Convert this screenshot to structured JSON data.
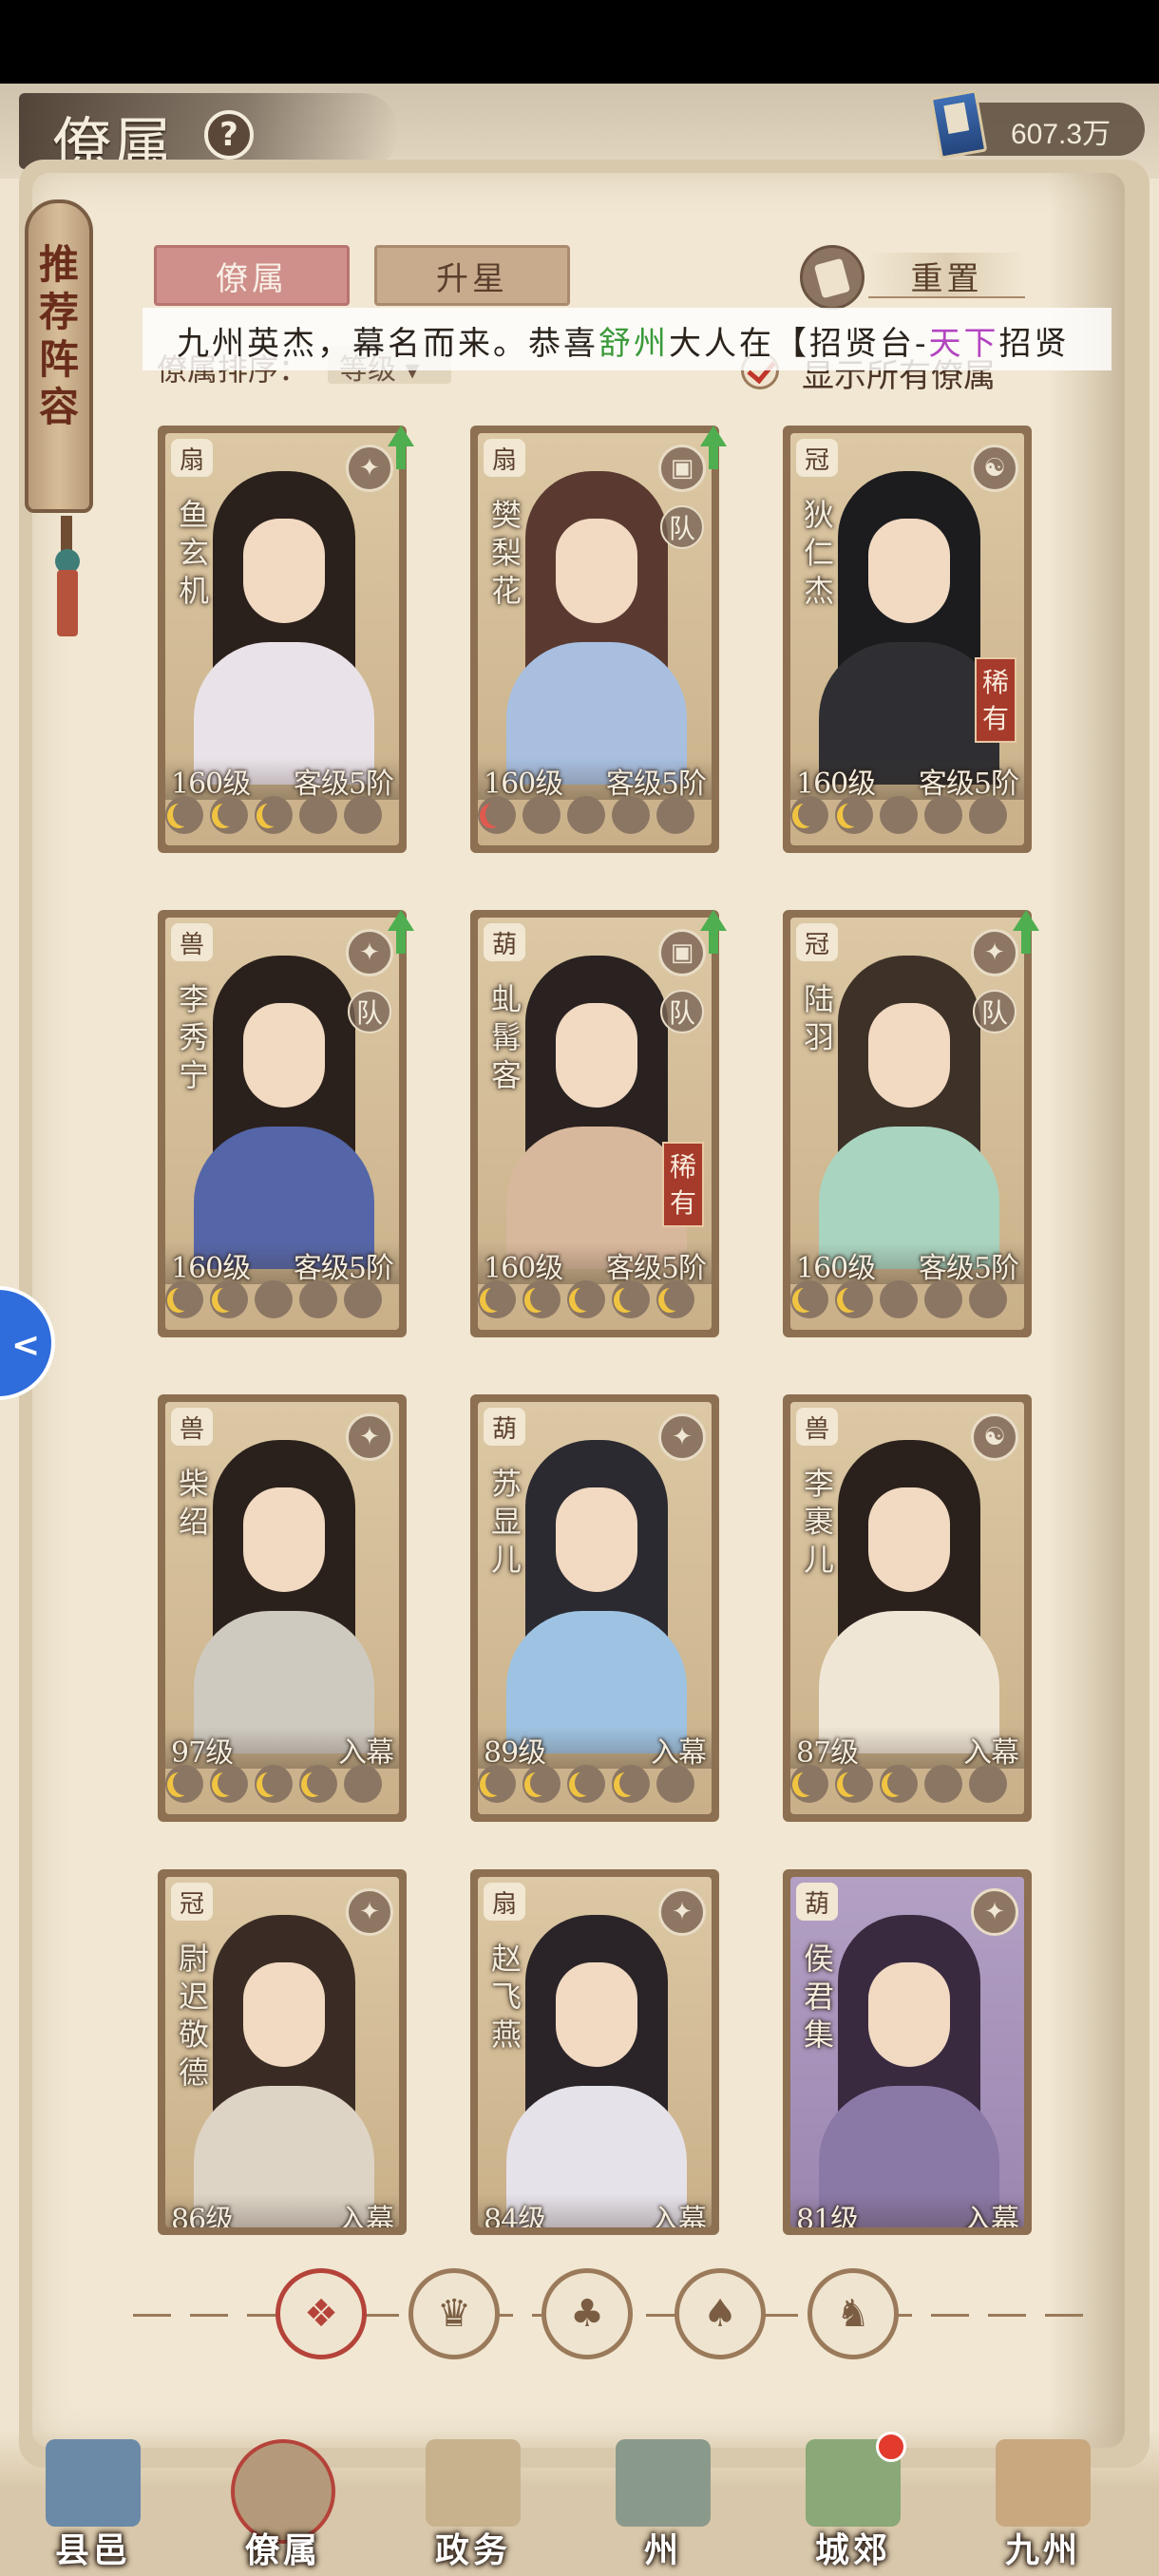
{
  "header": {
    "title": "僚属",
    "help_icon": "?",
    "currency_value": "607.3万"
  },
  "bookmark": {
    "label": "推荐阵容"
  },
  "tabs": [
    {
      "label": "僚属",
      "active": true
    },
    {
      "label": "升星",
      "active": false
    }
  ],
  "reset_label": "重置",
  "marquee": {
    "part1": "九州英杰，幕名而来。恭喜",
    "player": "舒州",
    "part2": "大人在【招贤台-",
    "event": "天下",
    "part3": "招贤"
  },
  "sort": {
    "label": "僚属排序：",
    "value": "等级"
  },
  "show_all_label": "显示所有僚属",
  "cards": [
    {
      "name": "鱼玄机",
      "level": "160级",
      "stage": "客级5阶",
      "cat": "扇",
      "role": "✦",
      "team": false,
      "rare": false,
      "upgrade": true,
      "moons": [
        "on",
        "on",
        "on",
        "off",
        "off"
      ],
      "body_color": "#e9e2e8",
      "hair_color": "#2b211c"
    },
    {
      "name": "樊梨花",
      "level": "160级",
      "stage": "客级5阶",
      "cat": "扇",
      "role": "▣",
      "team": true,
      "rare": false,
      "upgrade": true,
      "moons": [
        "red",
        "off",
        "off",
        "off",
        "off"
      ],
      "body_color": "#a8bfe0",
      "hair_color": "#5a3a30"
    },
    {
      "name": "狄仁杰",
      "level": "160级",
      "stage": "客级5阶",
      "cat": "冠",
      "role": "☯",
      "team": false,
      "rare": true,
      "upgrade": false,
      "moons": [
        "on",
        "on",
        "off",
        "off",
        "off"
      ],
      "body_color": "#2f2f33",
      "hair_color": "#1c1c1e"
    },
    {
      "name": "李秀宁",
      "level": "160级",
      "stage": "客级5阶",
      "cat": "兽",
      "role": "✦",
      "team": true,
      "rare": false,
      "upgrade": true,
      "moons": [
        "on",
        "on",
        "off",
        "off",
        "off"
      ],
      "body_color": "#5566a8",
      "hair_color": "#2b211c"
    },
    {
      "name": "虬髯客",
      "level": "160级",
      "stage": "客级5阶",
      "cat": "葫",
      "role": "▣",
      "team": true,
      "rare": true,
      "upgrade": true,
      "moons": [
        "on",
        "on",
        "on",
        "on",
        "on"
      ],
      "body_color": "#d8b89c",
      "hair_color": "#2a2220"
    },
    {
      "name": "陆羽",
      "level": "160级",
      "stage": "客级5阶",
      "cat": "冠",
      "role": "✦",
      "team": true,
      "rare": false,
      "upgrade": true,
      "moons": [
        "on",
        "on",
        "off",
        "off",
        "off"
      ],
      "body_color": "#a9d4c0",
      "hair_color": "#3d3128"
    },
    {
      "name": "柴绍",
      "level": "97级",
      "stage": "入幕",
      "cat": "兽",
      "role": "✦",
      "team": false,
      "rare": false,
      "upgrade": false,
      "moons": [
        "on",
        "on",
        "on",
        "on",
        "off"
      ],
      "body_color": "#cfcac0",
      "hair_color": "#2b211c"
    },
    {
      "name": "苏显儿",
      "level": "89级",
      "stage": "入幕",
      "cat": "葫",
      "role": "✦",
      "team": false,
      "rare": false,
      "upgrade": false,
      "moons": [
        "on",
        "on",
        "on",
        "on",
        "off"
      ],
      "body_color": "#9ec3e2",
      "hair_color": "#2b2a30"
    },
    {
      "name": "李裹儿",
      "level": "87级",
      "stage": "入幕",
      "cat": "兽",
      "role": "☯",
      "team": false,
      "rare": false,
      "upgrade": false,
      "moons": [
        "on",
        "on",
        "on",
        "off",
        "off"
      ],
      "body_color": "#efe6d6",
      "hair_color": "#2b211c"
    },
    {
      "name": "尉迟敬德",
      "level": "86级",
      "stage": "入幕",
      "cat": "冠",
      "role": "✦",
      "team": false,
      "rare": false,
      "upgrade": false,
      "moons": [],
      "body_color": "#ddd4c6",
      "hair_color": "#3a2c24"
    },
    {
      "name": "赵飞燕",
      "level": "84级",
      "stage": "入幕",
      "cat": "扇",
      "role": "✦",
      "team": false,
      "rare": false,
      "upgrade": false,
      "moons": [],
      "body_color": "#e6e2ea",
      "hair_color": "#2a2428"
    },
    {
      "name": "侯君集",
      "level": "81级",
      "stage": "入幕",
      "cat": "葫",
      "role": "✦",
      "team": false,
      "rare": false,
      "upgrade": false,
      "moons": [],
      "body_color": "#8a78a6",
      "hair_color": "#3a2a40",
      "purple": true
    }
  ],
  "filters": [
    {
      "name": "all",
      "icon": "❖",
      "active": true
    },
    {
      "name": "hat",
      "icon": "♛",
      "active": false
    },
    {
      "name": "gourd",
      "icon": "♣",
      "active": false
    },
    {
      "name": "fan",
      "icon": "♠",
      "active": false
    },
    {
      "name": "beast",
      "icon": "♞",
      "active": false
    }
  ],
  "nav": [
    {
      "label": "县邑",
      "color": "#6a8aa8",
      "active": false,
      "dot": false
    },
    {
      "label": "僚属",
      "color": "#b49a7a",
      "active": true,
      "dot": false
    },
    {
      "label": "政务",
      "color": "#c8b28e",
      "active": false,
      "dot": false
    },
    {
      "label": "州",
      "color": "#8a9a8a",
      "active": false,
      "dot": false
    },
    {
      "label": "城郊",
      "color": "#8aa878",
      "active": false,
      "dot": true
    },
    {
      "label": "九州",
      "color": "#c9a880",
      "active": false,
      "dot": false
    }
  ],
  "side_float_icon": "<"
}
